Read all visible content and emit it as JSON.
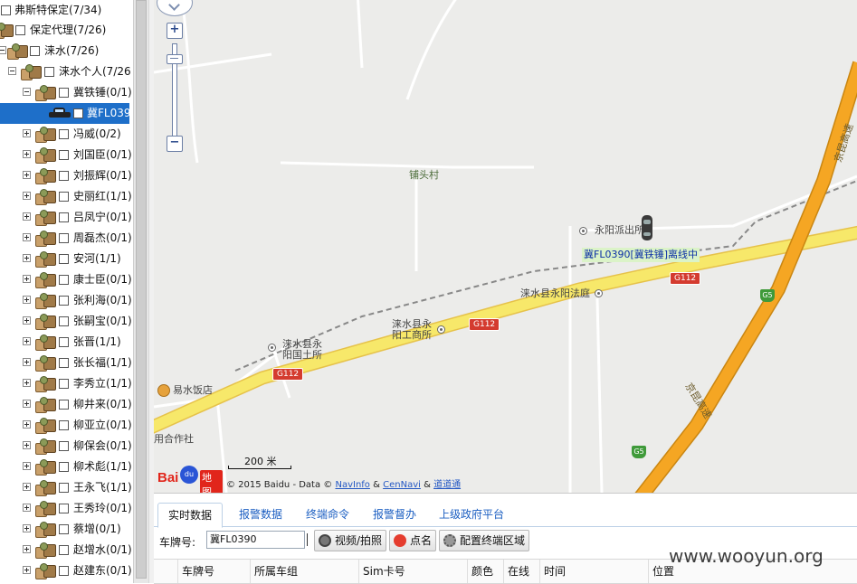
{
  "tree": {
    "root": "弗斯特保定(7/34)",
    "agent": "保定代理(7/26)",
    "region": "涞水(7/26)",
    "personal": "涞水个人(7/26",
    "owner_open": "冀铁锤(0/1)",
    "vehicle_selected": "冀FL039",
    "owners": [
      "冯威(0/2)",
      "刘国臣(0/1)",
      "刘振辉(0/1)",
      "史丽红(1/1)",
      "吕凤宁(0/1)",
      "周磊杰(0/1)",
      "安河(1/1)",
      "康士臣(0/1)",
      "张利海(0/1)",
      "张嗣宝(0/1)",
      "张晋(1/1)",
      "张长福(1/1)",
      "李秀立(1/1)",
      "柳井来(0/1)",
      "柳亚立(0/1)",
      "柳保会(0/1)",
      "柳术彪(1/1)",
      "王永飞(1/1)",
      "王秀玲(0/1)",
      "蔡增(0/1)",
      "赵增水(0/1)",
      "赵建东(0/1)"
    ]
  },
  "map": {
    "vehicle_label": "冀FL0390[冀铁锤]离线中",
    "places": {
      "village": "铺头村",
      "police": "永阳派出所",
      "court": "涞水县永阳法庭",
      "industry_line1": "涞水县永",
      "industry_line2": "阳工商所",
      "land_line1": "涞水县永",
      "land_line2": "阳国土所",
      "restaurant": "易水饭店",
      "coop": "用合作社"
    },
    "roads": {
      "g112": "G112",
      "g5": "G5",
      "expressway": "京昆高速"
    },
    "zoom": {
      "in": "+",
      "out": "−"
    },
    "scale": "200 米",
    "logo_bai": "Bai",
    "logo_du": "du",
    "logo_ditu": "地图",
    "copyright_prefix": "© 2015 Baidu - Data ©",
    "copyright_links": [
      "NavInfo",
      "CenNavi",
      "道道通"
    ],
    "copyright_amp": "&"
  },
  "tabs": [
    "实时数据",
    "报警数据",
    "终端命令",
    "报警督办",
    "上级政府平台"
  ],
  "toolbar": {
    "plate_label": "车牌号:",
    "plate_value": "冀FL0390",
    "video_button": "视频/拍照",
    "rollcall_button": "点名",
    "config_button": "配置终端区域"
  },
  "grid_columns": [
    "车牌号",
    "所属车组",
    "Sim卡号",
    "颜色",
    "在线",
    "时间",
    "位置"
  ],
  "watermark": "www.wooyun.org",
  "colors": {
    "selection": "#1e6fc9",
    "link": "#1c5fc2",
    "vehicle_label_bg": "#dbf3c8",
    "highway": "#f5a623",
    "national_road": "#f7e86a"
  }
}
